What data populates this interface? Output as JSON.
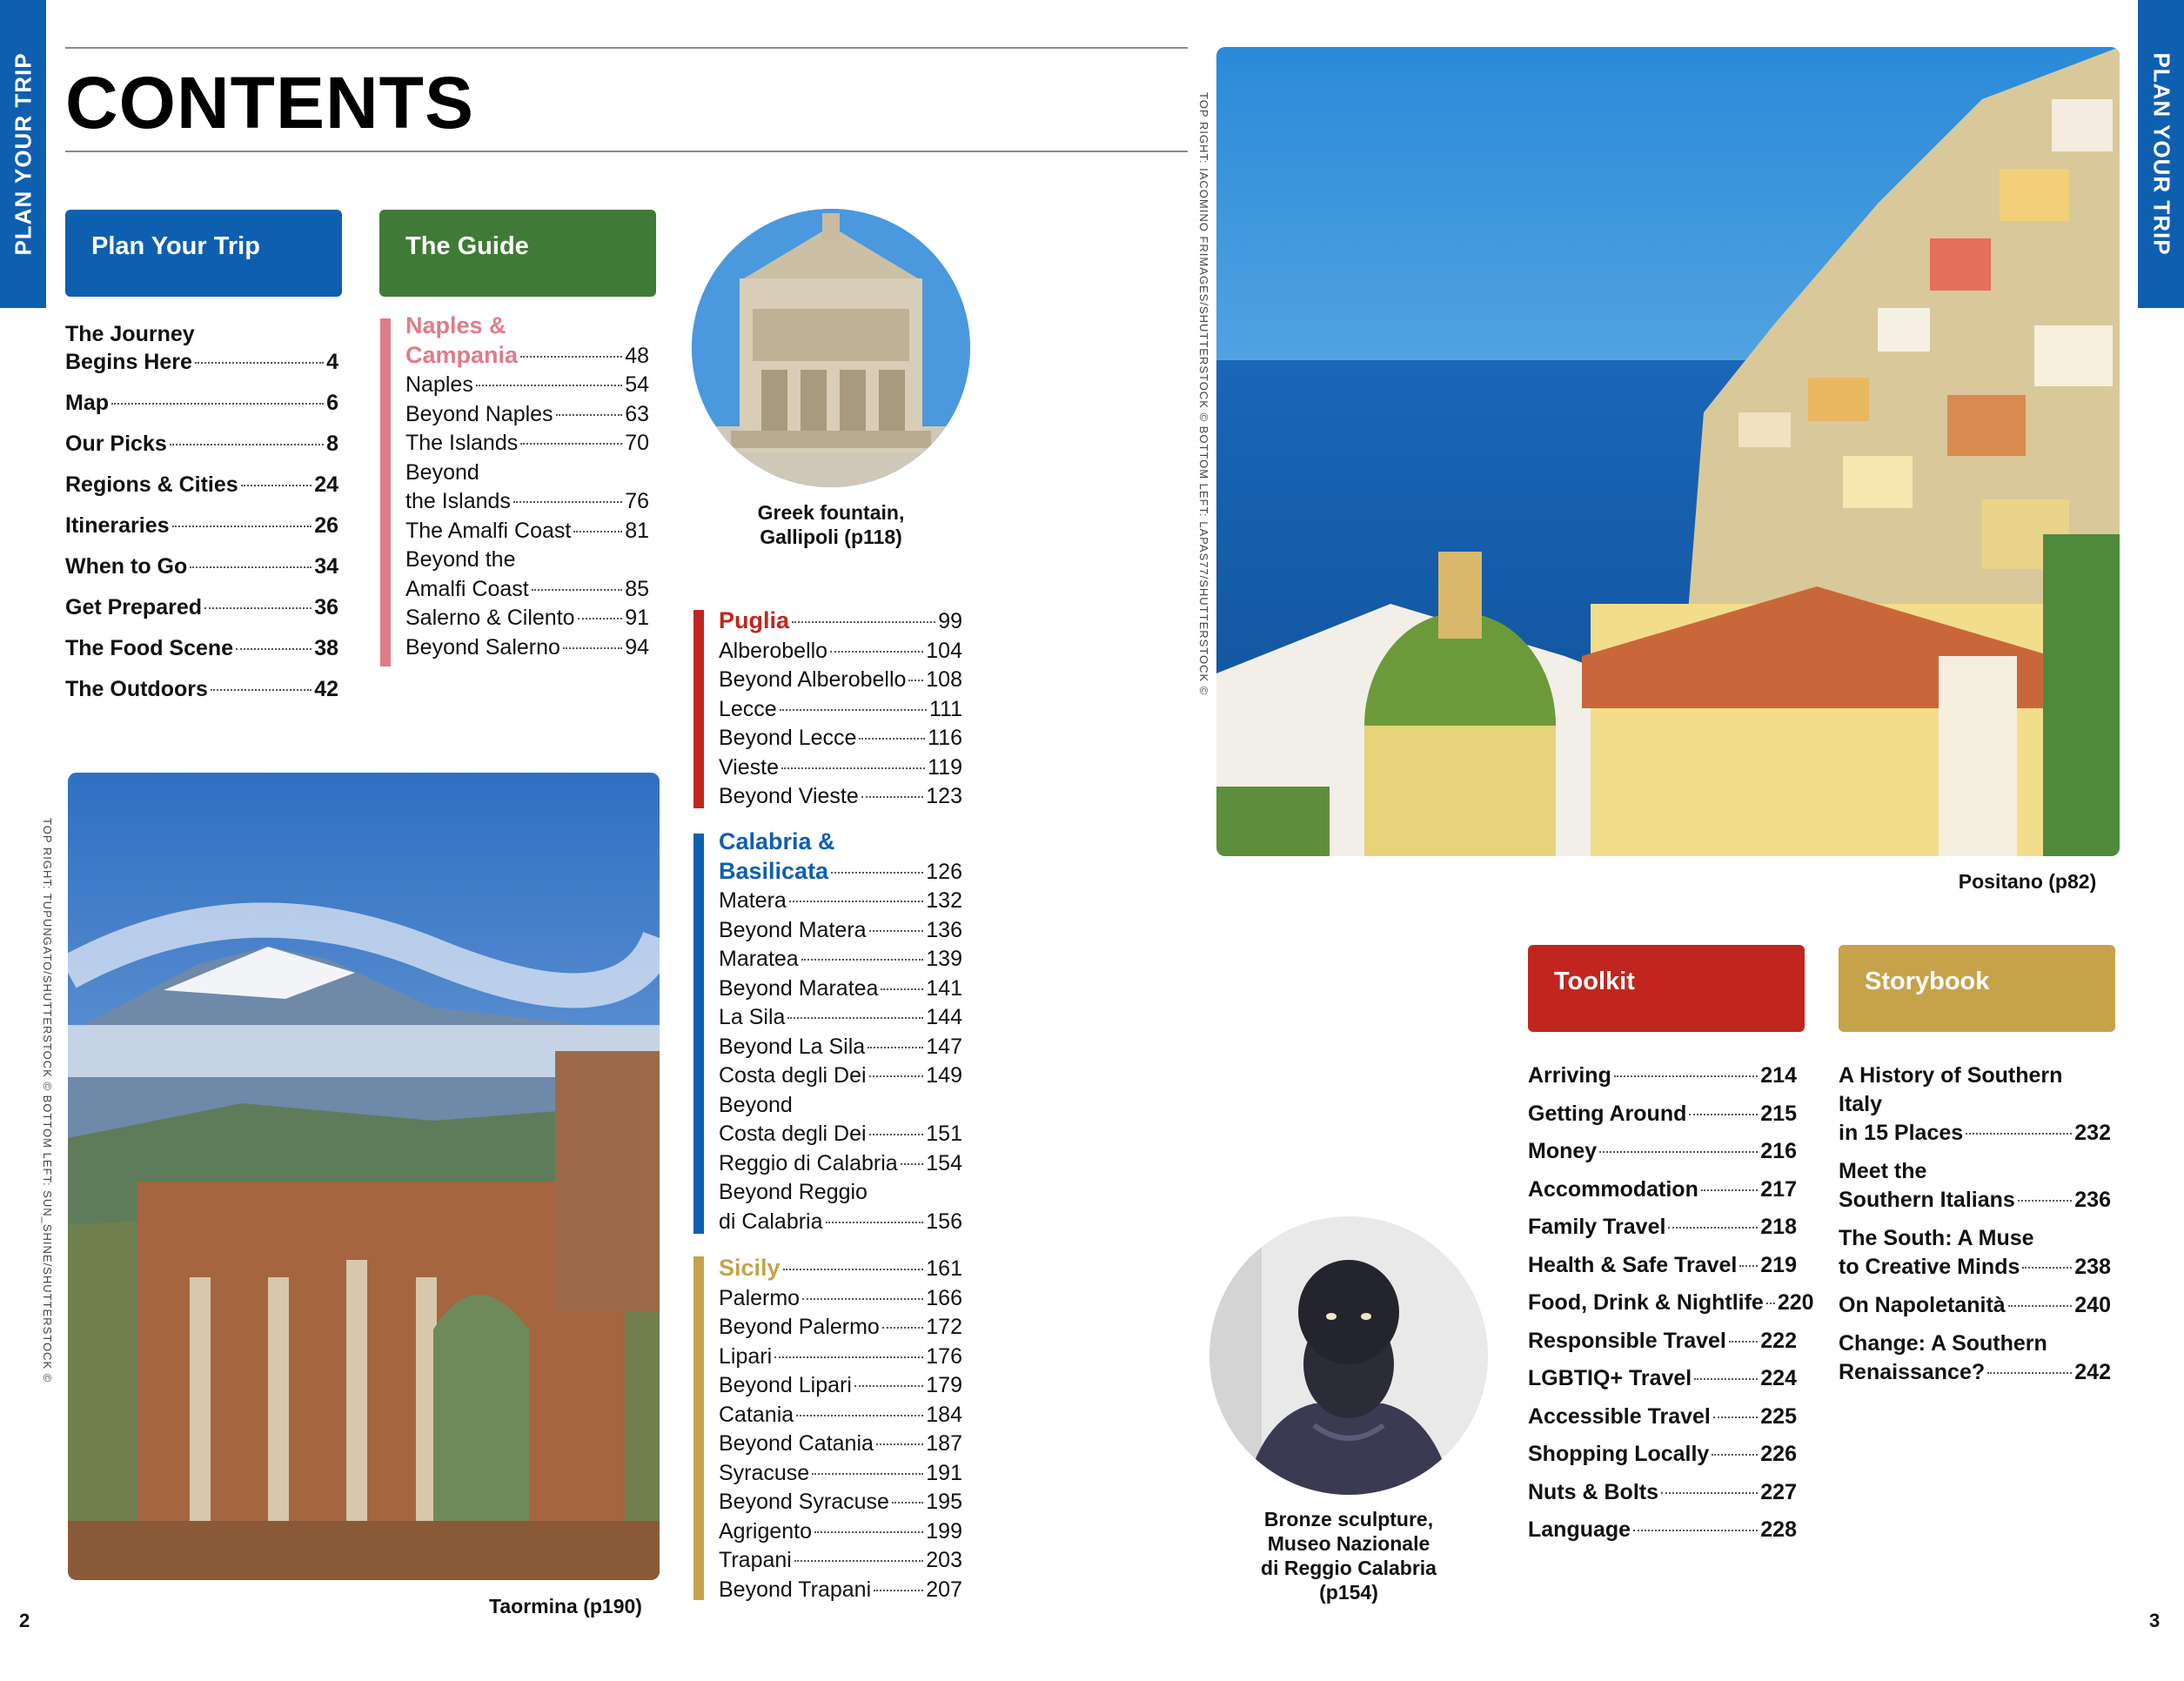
{
  "side_tab": "PLAN YOUR TRIP",
  "page_title": "CONTENTS",
  "plan_your_trip": {
    "header": "Plan Your Trip",
    "items": [
      {
        "lines": [
          "The Journey"
        ],
        "label": "Begins Here",
        "page": "4"
      },
      {
        "lines": [],
        "label": "Map",
        "page": "6"
      },
      {
        "lines": [],
        "label": "Our Picks",
        "page": "8"
      },
      {
        "lines": [],
        "label": "Regions & Cities",
        "page": "24"
      },
      {
        "lines": [],
        "label": "Itineraries",
        "page": "26"
      },
      {
        "lines": [],
        "label": "When to Go",
        "page": "34"
      },
      {
        "lines": [],
        "label": "Get Prepared",
        "page": "36"
      },
      {
        "lines": [],
        "label": "The Food Scene",
        "page": "38"
      },
      {
        "lines": [],
        "label": "The Outdoors",
        "page": "42"
      }
    ]
  },
  "the_guide": {
    "header": "The Guide",
    "sections": [
      {
        "color": "#e07b88",
        "items": [
          {
            "head": true,
            "lines": [
              "Naples &"
            ],
            "label": "Campania",
            "page": "48"
          },
          {
            "lines": [],
            "label": "Naples",
            "page": "54"
          },
          {
            "lines": [],
            "label": "Beyond Naples",
            "page": "63"
          },
          {
            "lines": [],
            "label": "The Islands",
            "page": "70"
          },
          {
            "lines": [
              "Beyond"
            ],
            "label": "the Islands",
            "page": "76"
          },
          {
            "lines": [],
            "label": "The Amalfi Coast",
            "page": "81"
          },
          {
            "lines": [
              "Beyond the"
            ],
            "label": "Amalfi Coast",
            "page": "85"
          },
          {
            "lines": [],
            "label": "Salerno & Cilento",
            "page": "91"
          },
          {
            "lines": [],
            "label": "Beyond Salerno",
            "page": "94"
          }
        ]
      },
      {
        "color": "#c0261f",
        "items": [
          {
            "head": true,
            "lines": [],
            "label": "Puglia",
            "page": "99"
          },
          {
            "lines": [],
            "label": "Alberobello",
            "page": "104"
          },
          {
            "lines": [],
            "label": "Beyond Alberobello",
            "page": "108"
          },
          {
            "lines": [],
            "label": "Lecce",
            "page": "111"
          },
          {
            "lines": [],
            "label": "Beyond Lecce",
            "page": "116"
          },
          {
            "lines": [],
            "label": "Vieste",
            "page": "119"
          },
          {
            "lines": [],
            "label": "Beyond Vieste",
            "page": "123"
          }
        ]
      },
      {
        "color": "#0f5fb0",
        "items": [
          {
            "head": true,
            "lines": [
              "Calabria &"
            ],
            "label": "Basilicata",
            "page": "126"
          },
          {
            "lines": [],
            "label": "Matera",
            "page": "132"
          },
          {
            "lines": [],
            "label": "Beyond Matera",
            "page": "136"
          },
          {
            "lines": [],
            "label": "Maratea",
            "page": "139"
          },
          {
            "lines": [],
            "label": "Beyond Maratea",
            "page": "141"
          },
          {
            "lines": [],
            "label": "La Sila",
            "page": "144"
          },
          {
            "lines": [],
            "label": "Beyond La Sila",
            "page": "147"
          },
          {
            "lines": [],
            "label": "Costa degli Dei",
            "page": "149"
          },
          {
            "lines": [
              "Beyond"
            ],
            "label": "Costa degli Dei",
            "page": "151"
          },
          {
            "lines": [],
            "label": "Reggio di Calabria",
            "page": "154"
          },
          {
            "lines": [
              "Beyond Reggio"
            ],
            "label": "di Calabria",
            "page": "156"
          }
        ]
      },
      {
        "color": "#c6a24a",
        "items": [
          {
            "head": true,
            "lines": [],
            "label": "Sicily",
            "page": "161"
          },
          {
            "lines": [],
            "label": "Palermo",
            "page": "166"
          },
          {
            "lines": [],
            "label": "Beyond Palermo",
            "page": "172"
          },
          {
            "lines": [],
            "label": "Lipari",
            "page": "176"
          },
          {
            "lines": [],
            "label": "Beyond Lipari",
            "page": "179"
          },
          {
            "lines": [],
            "label": "Catania",
            "page": "184"
          },
          {
            "lines": [],
            "label": "Beyond Catania",
            "page": "187"
          },
          {
            "lines": [],
            "label": "Syracuse",
            "page": "191"
          },
          {
            "lines": [],
            "label": "Beyond Syracuse",
            "page": "195"
          },
          {
            "lines": [],
            "label": "Agrigento",
            "page": "199"
          },
          {
            "lines": [],
            "label": "Trapani",
            "page": "203"
          },
          {
            "lines": [],
            "label": "Beyond Trapani",
            "page": "207"
          }
        ]
      }
    ]
  },
  "toolkit": {
    "header": "Toolkit",
    "items": [
      {
        "label": "Arriving",
        "page": "214"
      },
      {
        "label": "Getting Around",
        "page": "215"
      },
      {
        "label": "Money",
        "page": "216"
      },
      {
        "label": "Accommodation",
        "page": "217"
      },
      {
        "label": "Family Travel",
        "page": "218"
      },
      {
        "label": "Health & Safe Travel",
        "page": "219"
      },
      {
        "label": "Food, Drink & Nightlife",
        "page": "220"
      },
      {
        "label": "Responsible Travel",
        "page": "222"
      },
      {
        "label": "LGBTIQ+ Travel",
        "page": "224"
      },
      {
        "label": "Accessible Travel",
        "page": "225"
      },
      {
        "label": "Shopping Locally",
        "page": "226"
      },
      {
        "label": "Nuts & Bolts",
        "page": "227"
      },
      {
        "label": "Language",
        "page": "228"
      }
    ]
  },
  "storybook": {
    "header": "Storybook",
    "items": [
      {
        "lines": [
          "A History of Southern Italy"
        ],
        "label": "in 15 Places",
        "page": "232"
      },
      {
        "lines": [
          "Meet the"
        ],
        "label": "Southern Italians",
        "page": "236"
      },
      {
        "lines": [
          "The South: A Muse"
        ],
        "label": "to Creative Minds",
        "page": "238"
      },
      {
        "lines": [],
        "label": "On Napoletanità",
        "page": "240"
      },
      {
        "lines": [
          "Change: A Southern"
        ],
        "label": "Renaissance?",
        "page": "242"
      }
    ]
  },
  "captions": {
    "fountain": [
      "Greek fountain,",
      "Gallipoli (p118)"
    ],
    "taormina": "Taormina (p190)",
    "positano": "Positano (p82)",
    "bronze": [
      "Bronze sculpture,",
      "Museo Nazionale",
      "di Reggio Calabria",
      "(p154)"
    ]
  },
  "credits": {
    "left": "TOP RIGHT: TUPUNGATO/SHUTTERSTOCK © BOTTOM LEFT: SUN_SHINE/SHUTTERSTOCK ©",
    "right": "TOP RIGHT: IACOMINO FRIMAGES/SHUTTERSTOCK © BOTTOM LEFT: LAPAS77/SHUTTERSTOCK ©"
  },
  "page_numbers": {
    "left": "2",
    "right": "3"
  }
}
